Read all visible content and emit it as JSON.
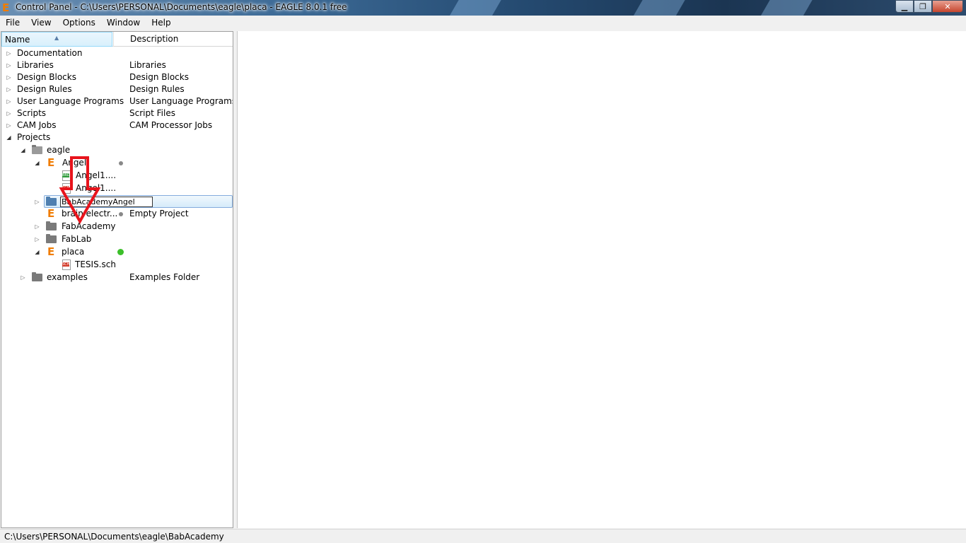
{
  "window": {
    "title": "Control Panel - C:\\Users\\PERSONAL\\Documents\\eagle\\placa - EAGLE 8.0.1 free",
    "app_icon": "E",
    "buttons": {
      "minimize": "▁",
      "maximize": "❐",
      "close": "✕"
    }
  },
  "menu": [
    "File",
    "View",
    "Options",
    "Window",
    "Help"
  ],
  "tree": {
    "columns": {
      "name": "Name",
      "description": "Description"
    },
    "rows": [
      {
        "label": "Documentation",
        "desc": ""
      },
      {
        "label": "Libraries",
        "desc": "Libraries"
      },
      {
        "label": "Design Blocks",
        "desc": "Design Blocks"
      },
      {
        "label": "Design Rules",
        "desc": "Design Rules"
      },
      {
        "label": "User Language Programs",
        "desc": "User Language Programs"
      },
      {
        "label": "Scripts",
        "desc": "Script Files"
      },
      {
        "label": "CAM Jobs",
        "desc": "CAM Processor Jobs"
      },
      {
        "label": "Projects",
        "desc": ""
      },
      {
        "label": "eagle",
        "desc": ""
      },
      {
        "label": "Angel",
        "desc": ""
      },
      {
        "label": "Angel1....",
        "desc": ""
      },
      {
        "label": "Angel1....",
        "desc": ""
      },
      {
        "label": "BabAcademyAngel",
        "desc": ""
      },
      {
        "label": "brain electr...",
        "desc": "Empty Project"
      },
      {
        "label": "FabAcademy",
        "desc": ""
      },
      {
        "label": "FabLab",
        "desc": ""
      },
      {
        "label": "placa",
        "desc": ""
      },
      {
        "label": "TESIS.sch",
        "desc": ""
      },
      {
        "label": "examples",
        "desc": "Examples Folder"
      }
    ]
  },
  "file_tags": {
    "brd": "BRD",
    "sch": "SCH"
  },
  "status": {
    "path": "C:\\Users\\PERSONAL\\Documents\\eagle\\BabAcademy"
  },
  "colors": {
    "accent_orange": "#f07c00",
    "selection": "#d5ebfa",
    "arrow_red": "#e8141c",
    "active_dot": "#3cbf2a"
  }
}
